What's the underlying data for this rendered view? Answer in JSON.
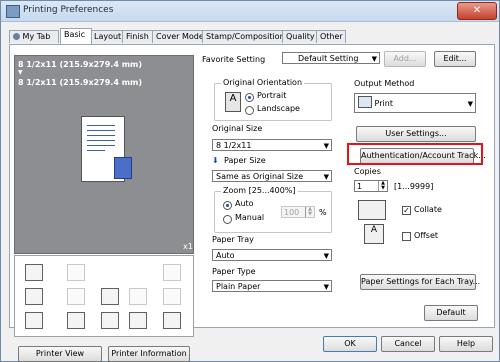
{
  "window": {
    "title": "Printing Preferences",
    "close_label": "✕"
  },
  "tabs": [
    {
      "label": "My Tab"
    },
    {
      "label": "Basic"
    },
    {
      "label": "Layout"
    },
    {
      "label": "Finish"
    },
    {
      "label": "Cover Mode"
    },
    {
      "label": "Stamp/Composition"
    },
    {
      "label": "Quality"
    },
    {
      "label": "Other"
    }
  ],
  "favorite": {
    "label": "Favorite Setting",
    "value": "Default Setting",
    "add_label": "Add...",
    "edit_label": "Edit..."
  },
  "preview": {
    "line1": "8 1/2x11 (215.9x279.4 mm)",
    "arrow": "▼",
    "line2": "8 1/2x11 (215.9x279.4 mm)",
    "count": "x1"
  },
  "orientation": {
    "legend": "Original Orientation",
    "options": [
      "Portrait",
      "Landscape"
    ],
    "selected": "Portrait"
  },
  "original_size": {
    "label": "Original Size",
    "value": "8 1/2x11"
  },
  "paper_size": {
    "label": "Paper Size",
    "value": "Same as Original Size"
  },
  "zoom": {
    "legend": "Zoom [25...400%]",
    "options": [
      "Auto",
      "Manual"
    ],
    "selected": "Auto",
    "value": "100",
    "unit": "%"
  },
  "paper_tray": {
    "label": "Paper Tray",
    "value": "Auto"
  },
  "paper_type": {
    "label": "Paper Type",
    "value": "Plain Paper"
  },
  "output_method": {
    "label": "Output Method",
    "value": "Print"
  },
  "user_settings_label": "User Settings...",
  "auth_label": "Authentication/Account Track...",
  "copies": {
    "label": "Copies",
    "value": "1",
    "range": "[1...9999]"
  },
  "collate": {
    "label": "Collate",
    "checked": true
  },
  "offset": {
    "label": "Offset",
    "checked": false
  },
  "paper_settings_label": "Paper Settings for Each Tray...",
  "printer_view_label": "Printer View",
  "printer_info_label": "Printer Information",
  "default_label": "Default",
  "footer": {
    "ok": "OK",
    "cancel": "Cancel",
    "help": "Help"
  },
  "colors": {
    "highlight": "#e3121d",
    "accent": "#1b4ea8"
  }
}
